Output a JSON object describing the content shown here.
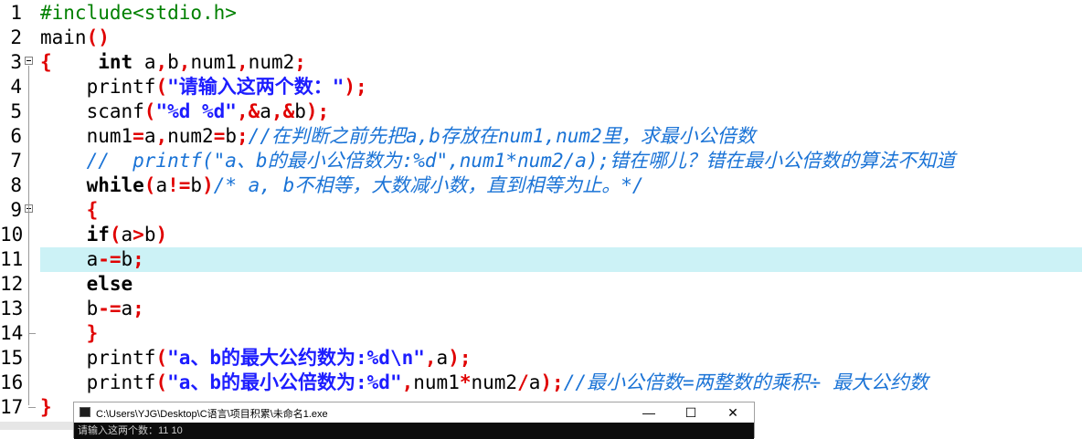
{
  "editor": {
    "lines": [
      {
        "no": "1",
        "tokens": [
          [
            "pp",
            "#include<stdio.h>"
          ]
        ]
      },
      {
        "no": "2",
        "tokens": [
          [
            "fn",
            "main"
          ],
          [
            "sym",
            "()"
          ]
        ]
      },
      {
        "no": "3",
        "tokens": [
          [
            "sym",
            "{"
          ],
          [
            "fn",
            "    "
          ],
          [
            "kw",
            "int"
          ],
          [
            "fn",
            " a"
          ],
          [
            "sym",
            ","
          ],
          [
            "fn",
            "b"
          ],
          [
            "sym",
            ","
          ],
          [
            "fn",
            "num1"
          ],
          [
            "sym",
            ","
          ],
          [
            "fn",
            "num2"
          ],
          [
            "sym",
            ";"
          ]
        ]
      },
      {
        "no": "4",
        "tokens": [
          [
            "fn",
            "    printf"
          ],
          [
            "sym",
            "("
          ],
          [
            "str",
            "\"请输入这两个数：\""
          ],
          [
            "sym",
            ");"
          ]
        ]
      },
      {
        "no": "5",
        "tokens": [
          [
            "fn",
            "    scanf"
          ],
          [
            "sym",
            "("
          ],
          [
            "str",
            "\"%d %d\""
          ],
          [
            "sym",
            ",&"
          ],
          [
            "fn",
            "a"
          ],
          [
            "sym",
            ",&"
          ],
          [
            "fn",
            "b"
          ],
          [
            "sym",
            ");"
          ]
        ]
      },
      {
        "no": "6",
        "tokens": [
          [
            "fn",
            "    num1"
          ],
          [
            "sym",
            "="
          ],
          [
            "fn",
            "a"
          ],
          [
            "sym",
            ","
          ],
          [
            "fn",
            "num2"
          ],
          [
            "sym",
            "="
          ],
          [
            "fn",
            "b"
          ],
          [
            "sym",
            ";"
          ],
          [
            "cm",
            "//在判断之前先把a,b存放在num1,num2里，求最小公倍数"
          ]
        ]
      },
      {
        "no": "7",
        "tokens": [
          [
            "cm",
            "    //  printf(\"a、b的最小公倍数为:%d\",num1*num2/a);错在哪儿？错在最小公倍数的算法不知道"
          ]
        ]
      },
      {
        "no": "8",
        "tokens": [
          [
            "kw",
            "    while"
          ],
          [
            "sym",
            "("
          ],
          [
            "fn",
            "a"
          ],
          [
            "sym",
            "!="
          ],
          [
            "fn",
            "b"
          ],
          [
            "sym",
            ")"
          ],
          [
            "cm",
            "/* a, b不相等，大数减小数，直到相等为止。*/"
          ]
        ]
      },
      {
        "no": "9",
        "tokens": [
          [
            "sym",
            "    {"
          ]
        ]
      },
      {
        "no": "10",
        "tokens": [
          [
            "kw",
            "    if"
          ],
          [
            "sym",
            "("
          ],
          [
            "fn",
            "a"
          ],
          [
            "sym",
            ">"
          ],
          [
            "fn",
            "b"
          ],
          [
            "sym",
            ")"
          ]
        ]
      },
      {
        "no": "11",
        "tokens": [
          [
            "fn",
            "    a"
          ],
          [
            "sym",
            "-="
          ],
          [
            "fn",
            "b"
          ],
          [
            "sym",
            ";"
          ]
        ]
      },
      {
        "no": "12",
        "tokens": [
          [
            "kw",
            "    else"
          ]
        ]
      },
      {
        "no": "13",
        "tokens": [
          [
            "fn",
            "    b"
          ],
          [
            "sym",
            "-="
          ],
          [
            "fn",
            "a"
          ],
          [
            "sym",
            ";"
          ]
        ]
      },
      {
        "no": "14",
        "tokens": [
          [
            "sym",
            "    }"
          ]
        ]
      },
      {
        "no": "15",
        "tokens": [
          [
            "fn",
            "    printf"
          ],
          [
            "sym",
            "("
          ],
          [
            "str",
            "\"a、b的最大公约数为:%d\\n\""
          ],
          [
            "sym",
            ","
          ],
          [
            "fn",
            "a"
          ],
          [
            "sym",
            ");"
          ]
        ]
      },
      {
        "no": "16",
        "tokens": [
          [
            "fn",
            "    printf"
          ],
          [
            "sym",
            "("
          ],
          [
            "str",
            "\"a、b的最小公倍数为:%d\""
          ],
          [
            "sym",
            ","
          ],
          [
            "fn",
            "num1"
          ],
          [
            "sym",
            "*"
          ],
          [
            "fn",
            "num2"
          ],
          [
            "sym",
            "/"
          ],
          [
            "fn",
            "a"
          ],
          [
            "sym",
            ");"
          ],
          [
            "cm",
            "//最小公倍数=两整数的乘积÷ 最大公约数"
          ]
        ]
      },
      {
        "no": "17",
        "tokens": [
          [
            "sym",
            "}"
          ]
        ]
      }
    ],
    "highlighted_line": "11",
    "fold_markers": [
      "3",
      "9"
    ]
  },
  "console": {
    "title": "C:\\Users\\YJG\\Desktop\\C语言\\项目积累\\未命名1.exe",
    "minimize": "—",
    "maximize": "☐",
    "close": "✕",
    "output": "请输入这两个数：11 10"
  },
  "colors": {
    "highlight": "#ccf2f6",
    "keyword": "#000000",
    "string": "#1d1dff",
    "symbol": "#e00000",
    "comment": "#1a73d6",
    "preprocessor": "#008000"
  }
}
